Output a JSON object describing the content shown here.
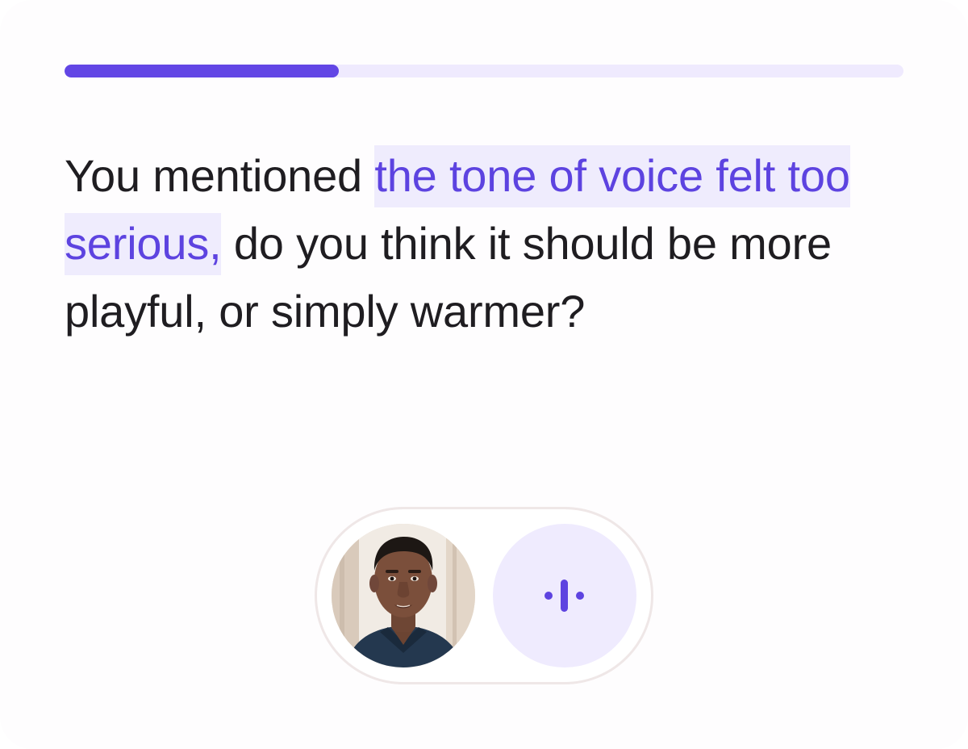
{
  "progress": {
    "fraction": 0.327
  },
  "question": {
    "prefix": "You mentioned ",
    "highlight": "the tone of voice felt too serious,",
    "suffix": " do you think it should be more playful, or simply warmer?"
  },
  "controls": {
    "avatar_icon": "participant-avatar",
    "voice_icon": "voice-waveform-icon"
  },
  "colors": {
    "accent": "#6246e5",
    "accent_light": "#efeafe",
    "text": "#1f1d21"
  }
}
